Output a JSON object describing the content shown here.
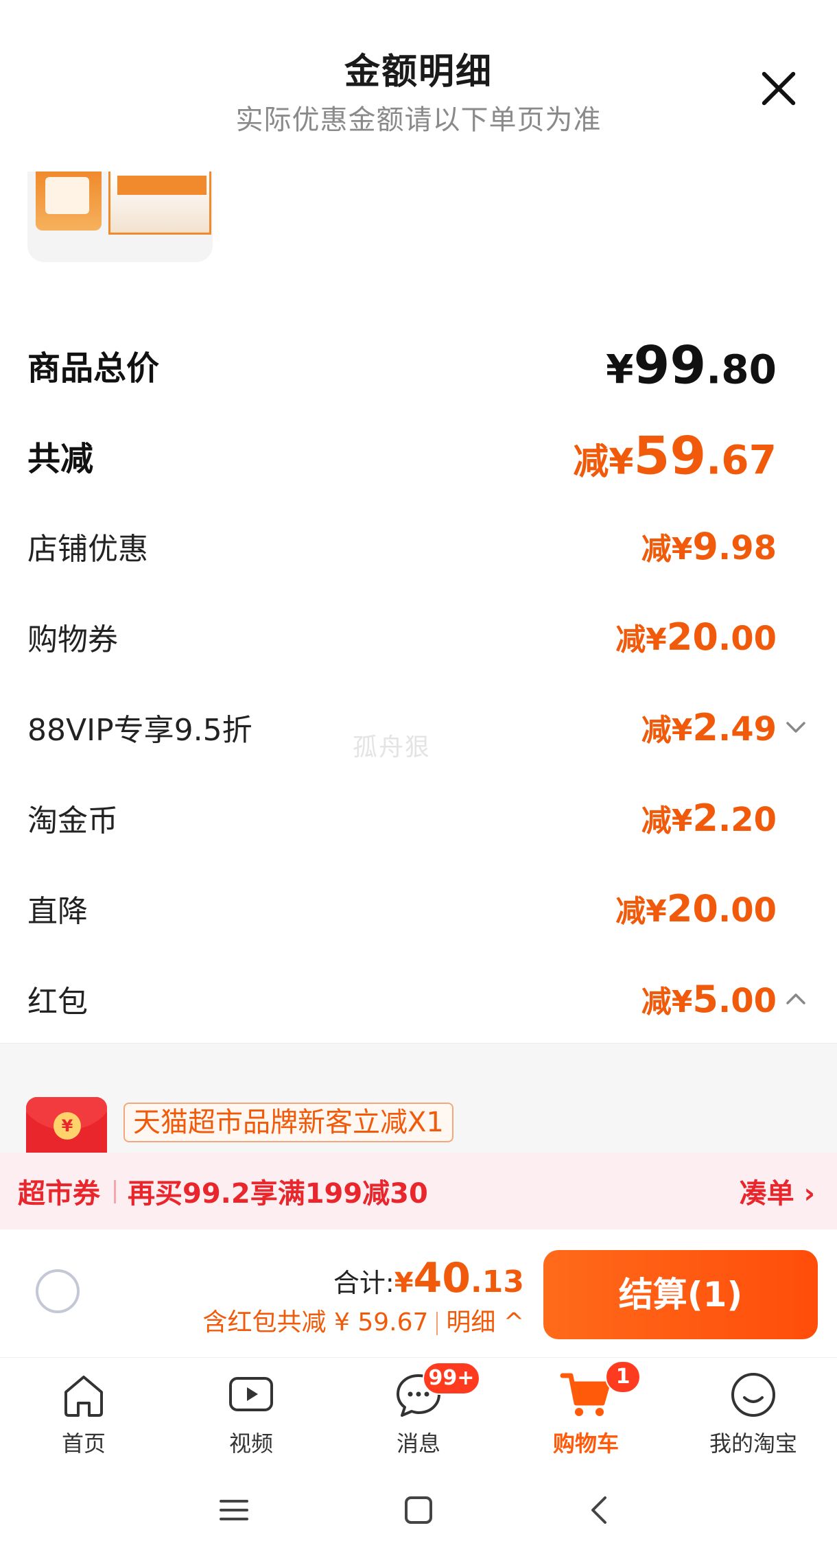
{
  "header": {
    "title": "金额明细",
    "subtitle": "实际优惠金额请以下单页为准"
  },
  "summary": {
    "total": {
      "label": "商品总价",
      "currency": "¥",
      "integer": "99",
      "decimal": ".80"
    },
    "reduction": {
      "label": "共减",
      "prefix": "减¥",
      "integer": "59",
      "decimal": ".67"
    }
  },
  "discounts": [
    {
      "label": "店铺优惠",
      "prefix": "减¥",
      "integer": "9",
      "decimal": ".98",
      "chevron": ""
    },
    {
      "label": "购物券",
      "prefix": "减¥",
      "integer": "20",
      "decimal": ".00",
      "chevron": ""
    },
    {
      "label": "88VIP专享9.5折",
      "prefix": "减¥",
      "integer": "2",
      "decimal": ".49",
      "chevron": "chevron-down"
    },
    {
      "label": "淘金币",
      "prefix": "减¥",
      "integer": "2",
      "decimal": ".20",
      "chevron": ""
    },
    {
      "label": "直降",
      "prefix": "减¥",
      "integer": "20",
      "decimal": ".00",
      "chevron": ""
    },
    {
      "label": "红包",
      "prefix": "减¥",
      "integer": "5",
      "decimal": ".00",
      "chevron": "chevron-up"
    }
  ],
  "watermark": "孤舟狠",
  "redpack": {
    "icon": "red-envelope-icon",
    "coin_symbol": "¥",
    "tag": "天猫超市品牌新客立减X1"
  },
  "coupon_bar": {
    "tag": "超市券",
    "message": "再买99.2享满199减30",
    "action": "凑单 ›"
  },
  "checkout": {
    "total_label": "合计:",
    "currency": "¥",
    "integer": "40",
    "decimal": ".13",
    "saving": "含红包共减 ¥ 59.67",
    "detail": "明细 ^",
    "button": "结算(1)"
  },
  "tabbar": {
    "items": [
      {
        "label": "首页",
        "icon": "home-icon"
      },
      {
        "label": "视频",
        "icon": "video-icon"
      },
      {
        "label": "消息",
        "icon": "message-icon",
        "badge": "99+"
      },
      {
        "label": "购物车",
        "icon": "cart-icon",
        "badge": "1",
        "active": true
      },
      {
        "label": "我的淘宝",
        "icon": "profile-icon"
      }
    ]
  },
  "system_nav": [
    "menu-icon",
    "home-square-icon",
    "back-icon"
  ],
  "colors": {
    "accent": "#f05a0a",
    "coupon_red": "#e8262b",
    "coupon_bg": "#fdeef1",
    "button_orange": "#ff5a0a"
  }
}
